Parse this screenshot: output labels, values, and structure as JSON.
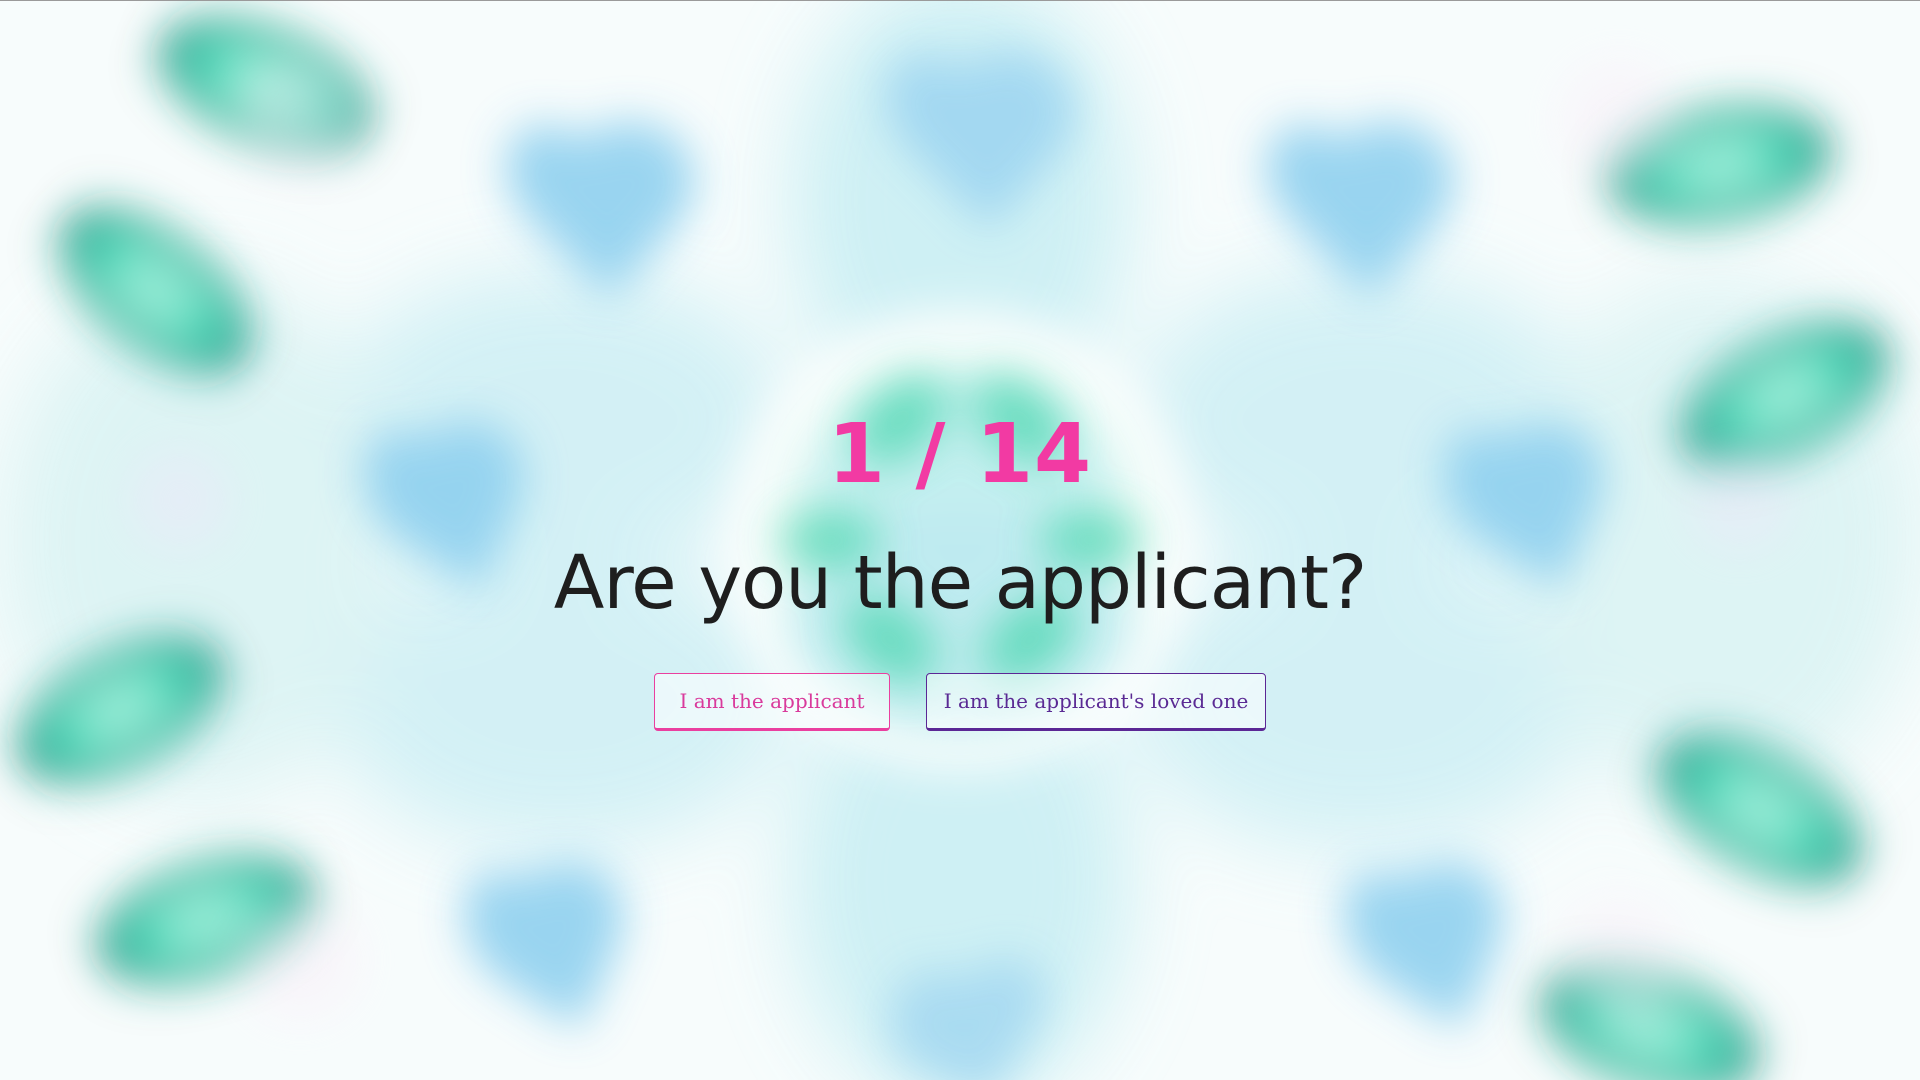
{
  "step": {
    "counter": "1 / 14"
  },
  "question": {
    "text": "Are you the applicant?"
  },
  "options": {
    "applicant_label": "I am the applicant",
    "loved_one_label": "I am the applicant's loved one"
  },
  "colors": {
    "accent_pink": "#f23aa3",
    "accent_purple": "#5b2795",
    "text_dark": "#1e1e1e",
    "bg_teal": "#1fd2b0",
    "bg_blue": "#6fc0e8"
  }
}
